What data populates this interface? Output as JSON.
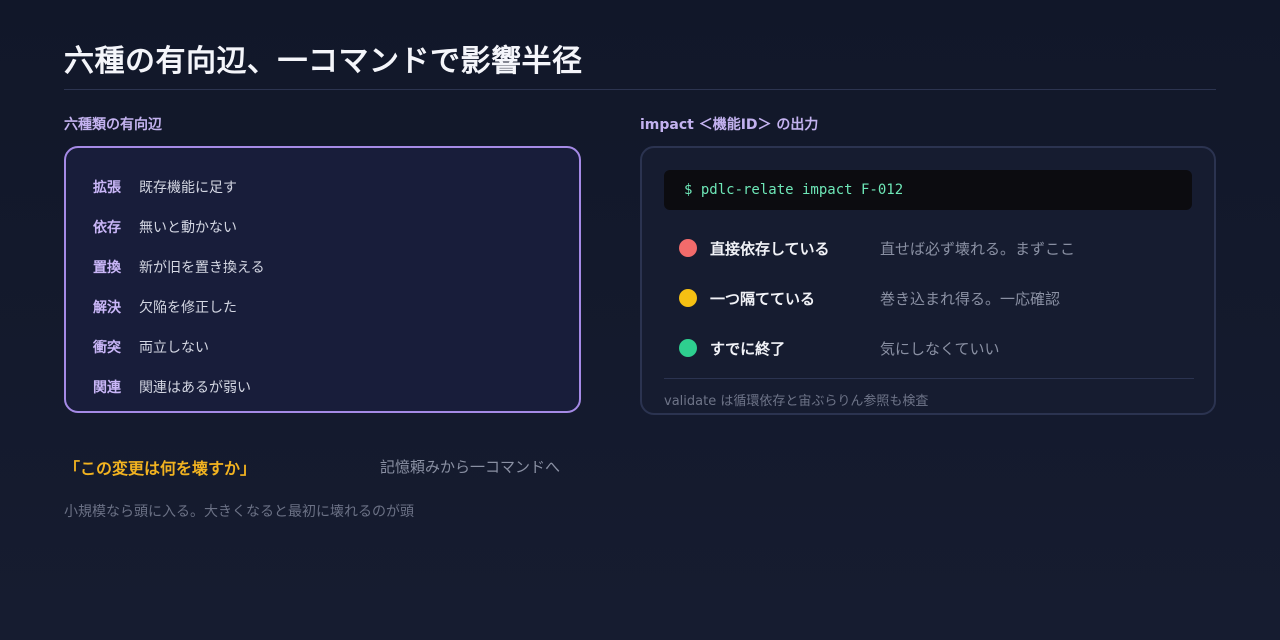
{
  "title": "六種の有向辺、一コマンドで影響半径",
  "relations": {
    "label": "六種類の有向辺",
    "items": [
      {
        "type": "拡張",
        "desc": "既存機能に足す"
      },
      {
        "type": "依存",
        "desc": "無いと動かない"
      },
      {
        "type": "置換",
        "desc": "新が旧を置き換える"
      },
      {
        "type": "解決",
        "desc": "欠陥を修正した"
      },
      {
        "type": "衝突",
        "desc": "両立しない"
      },
      {
        "type": "関連",
        "desc": "関連はあるが弱い"
      }
    ]
  },
  "output": {
    "label": "impact ＜機能ID＞ の出力",
    "command": "$ pdlc-relate impact F-012",
    "rows": [
      {
        "label": "直接依存している",
        "note": "直せば必ず壊れる。まずここ",
        "color": "#f26b6b"
      },
      {
        "label": "一つ隔てている",
        "note": "巻き込まれ得る。一応確認",
        "color": "#f5c013"
      },
      {
        "label": "すでに終了",
        "note": "気にしなくていい",
        "color": "#2ecf8f"
      }
    ],
    "footnote": "validate は循環依存と宙ぶらりん参照も検査"
  },
  "quote": {
    "text": "「この変更は何を壊すか」",
    "aside": "記憶頼みから一コマンドへ"
  },
  "subnote": "小規模なら頭に入る。大きくなると最初に壊れるのが頭"
}
